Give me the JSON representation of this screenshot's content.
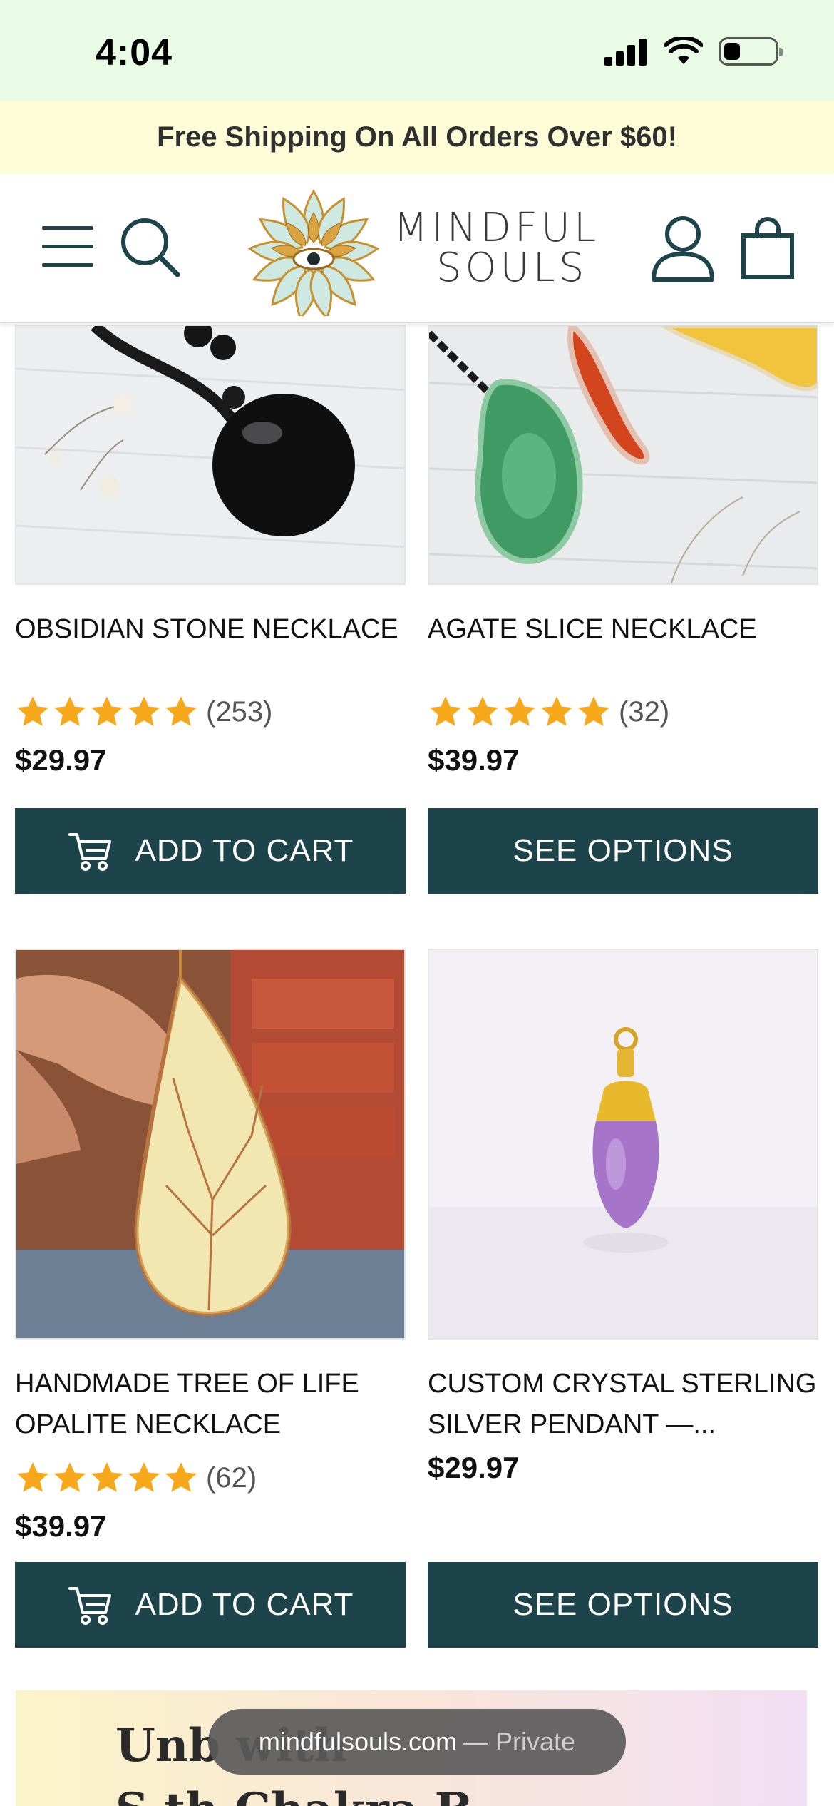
{
  "status_bar": {
    "time": "4:04",
    "icons": [
      "signal-icon",
      "wifi-icon",
      "battery-icon"
    ]
  },
  "promo_banner": {
    "text": "Free Shipping On All Orders Over $60!"
  },
  "header": {
    "logo_line1": "MINDFUL",
    "logo_line2": "SOULS",
    "icons": [
      "menu-icon",
      "search-icon",
      "account-icon",
      "cart-bag-icon"
    ]
  },
  "products": [
    {
      "title": "OBSIDIAN STONE NECKLACE",
      "rating": 5,
      "reviews": "(253)",
      "price": "$29.97",
      "cta": "ADD TO CART"
    },
    {
      "title": "AGATE SLICE NECKLACE",
      "rating": 5,
      "reviews": "(32)",
      "price": "$39.97",
      "cta": "SEE OPTIONS"
    },
    {
      "title": "HANDMADE TREE OF LIFE OPALITE NECKLACE",
      "rating": 5,
      "reviews": "(62)",
      "price": "$39.97",
      "cta": "ADD TO CART"
    },
    {
      "title": "CUSTOM CRYSTAL STERLING SILVER PENDANT —...",
      "price": "$29.97",
      "cta": "SEE OPTIONS"
    }
  ],
  "bottom_promo": {
    "line1": "Unb          with",
    "line2": "S     th  Chakra B"
  },
  "browser": {
    "url": "mindfulsouls.com",
    "mode": "— Private"
  },
  "colors": {
    "accent": "#1d434b",
    "star": "#f7a81b",
    "promo_bg": "#fefbd7",
    "status_bg": "#eafbe5"
  }
}
